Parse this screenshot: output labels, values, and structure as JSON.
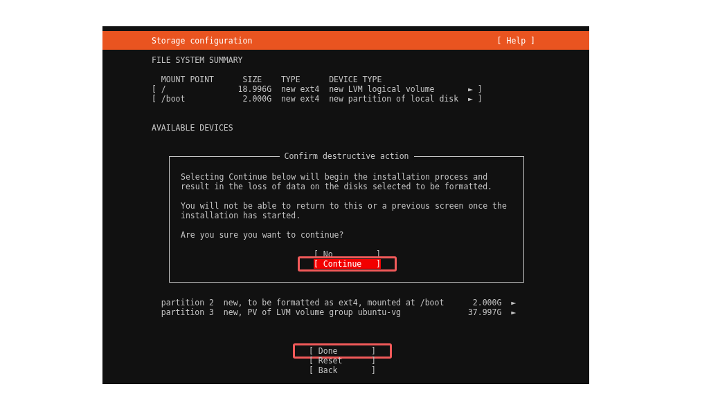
{
  "header": {
    "title": "Storage configuration",
    "help": "[ Help ]"
  },
  "summary": {
    "title": "FILE SYSTEM SUMMARY",
    "columns": [
      "MOUNT POINT",
      "SIZE",
      "TYPE",
      "DEVICE TYPE"
    ],
    "bracket_open": "[",
    "bracket_close": "]",
    "rows": [
      {
        "mount": "/",
        "size": "18.996G",
        "type": "new ext4",
        "device_type": "new LVM logical volume",
        "arrow": "►"
      },
      {
        "mount": "/boot",
        "size": "2.000G",
        "type": "new ext4",
        "device_type": "new partition of local disk",
        "arrow": "►"
      }
    ]
  },
  "devices": {
    "title": "AVAILABLE DEVICES",
    "rows": [
      {
        "name": "partition 2",
        "description": "new, to be formatted as ext4, mounted at /boot",
        "size": "2.000G",
        "arrow": "►"
      },
      {
        "name": "partition 3",
        "description": "new, PV of LVM volume group ubuntu-vg",
        "size": "37.997G",
        "arrow": "►"
      }
    ]
  },
  "dialog": {
    "title": "Confirm destructive action",
    "paragraphs": [
      "Selecting Continue below will begin the installation process and result in the loss of data on the disks selected to be formatted.",
      "You will not be able to return to this or a previous screen once the installation has started.",
      "Are you sure you want to continue?"
    ],
    "buttons": [
      {
        "label": "[ No         ]",
        "selected": false,
        "highlighted": false
      },
      {
        "label": "[ Continue   ]",
        "selected": true,
        "highlighted": true
      }
    ]
  },
  "buttons": [
    {
      "label": "[ Done       ]",
      "selected": false,
      "highlighted": true
    },
    {
      "label": "[ Reset      ]",
      "selected": false,
      "highlighted": false
    },
    {
      "label": "[ Back       ]",
      "selected": false,
      "highlighted": false
    }
  ]
}
